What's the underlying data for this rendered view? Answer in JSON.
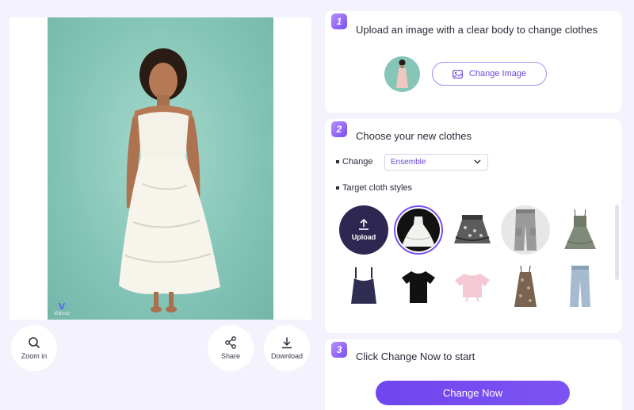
{
  "preview": {
    "watermark": "Vidnoz",
    "zoom_label": "Zoom in",
    "share_label": "Share",
    "download_label": "Download"
  },
  "step1": {
    "number": "1",
    "title": "Upload an image with a clear body to change clothes",
    "change_image_label": "Change Image"
  },
  "step2": {
    "number": "2",
    "title": "Choose your new clothes",
    "change_label": "Change",
    "change_value": "Ensemble",
    "target_label": "Target cloth styles",
    "upload_label": "Upload",
    "styles": [
      {
        "name": "wedding-dress",
        "selected": true
      },
      {
        "name": "floral-skirt"
      },
      {
        "name": "gray-cargo-pants"
      },
      {
        "name": "floral-mini-dress"
      },
      {
        "name": "navy-cami-top"
      },
      {
        "name": "black-tshirt"
      },
      {
        "name": "pink-crop-top"
      },
      {
        "name": "brown-print-dress"
      },
      {
        "name": "light-jeans"
      }
    ]
  },
  "step3": {
    "number": "3",
    "title": "Click Change Now to start",
    "button_label": "Change Now"
  },
  "colors": {
    "accent": "#7a4df3",
    "background": "#f4f2fd",
    "upload_circle": "#2e2752",
    "photo_bg": "#86c6b8"
  }
}
